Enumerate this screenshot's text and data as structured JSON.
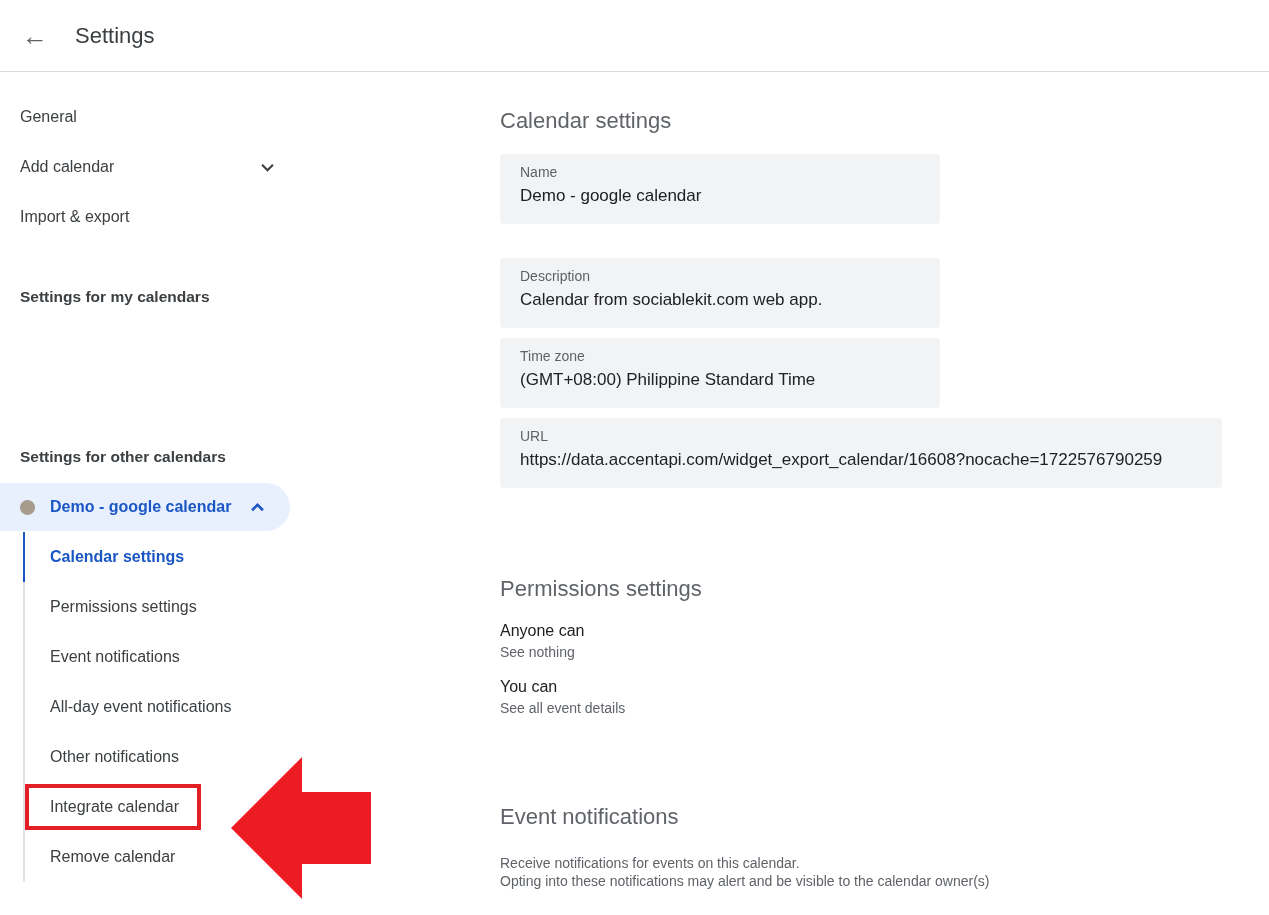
{
  "header": {
    "back_icon": "←",
    "title": "Settings"
  },
  "sidebar": {
    "items": [
      {
        "label": "General",
        "kind": "link"
      },
      {
        "label": "Add calendar",
        "kind": "expander",
        "expanded": false
      },
      {
        "label": "Import & export",
        "kind": "link"
      }
    ],
    "my_calendars_heading": "Settings for my calendars",
    "other_calendars_heading": "Settings for other calendars",
    "calendar": {
      "name": "Demo - google calendar",
      "color": "#a79b8e",
      "expanded": true,
      "selected": true,
      "subitems": [
        {
          "label": "Calendar settings",
          "selected": true,
          "highlighted": false
        },
        {
          "label": "Permissions settings",
          "selected": false,
          "highlighted": false
        },
        {
          "label": "Event notifications",
          "selected": false,
          "highlighted": false
        },
        {
          "label": "All-day event notifications",
          "selected": false,
          "highlighted": false
        },
        {
          "label": "Other notifications",
          "selected": false,
          "highlighted": false
        },
        {
          "label": "Integrate calendar",
          "selected": false,
          "highlighted": true
        },
        {
          "label": "Remove calendar",
          "selected": false,
          "highlighted": false
        }
      ]
    }
  },
  "sections": [
    {
      "title": "Calendar settings",
      "kind": "fields",
      "fields": [
        {
          "label": "Name",
          "value": "Demo - google calendar"
        },
        {
          "label": "Description",
          "value": "Calendar from sociablekit.com web app."
        },
        {
          "label": "Time zone",
          "value": "(GMT+08:00) Philippine Standard Time"
        },
        {
          "label": "URL",
          "value": "https://data.accentapi.com/widget_export_calendar/16608?nocache=1722576790259"
        }
      ]
    },
    {
      "title": "Permissions settings",
      "kind": "permissions",
      "rows": [
        {
          "title": "Anyone can",
          "value": "See nothing"
        },
        {
          "title": "You can",
          "value": "See all event details"
        }
      ]
    },
    {
      "title": "Event notifications",
      "kind": "notes",
      "lines": [
        "Receive notifications for events on this calendar.",
        "Opting into these notifications may alert and be visible to the calendar owner(s)"
      ]
    }
  ],
  "annotation": {
    "arrow": true
  }
}
